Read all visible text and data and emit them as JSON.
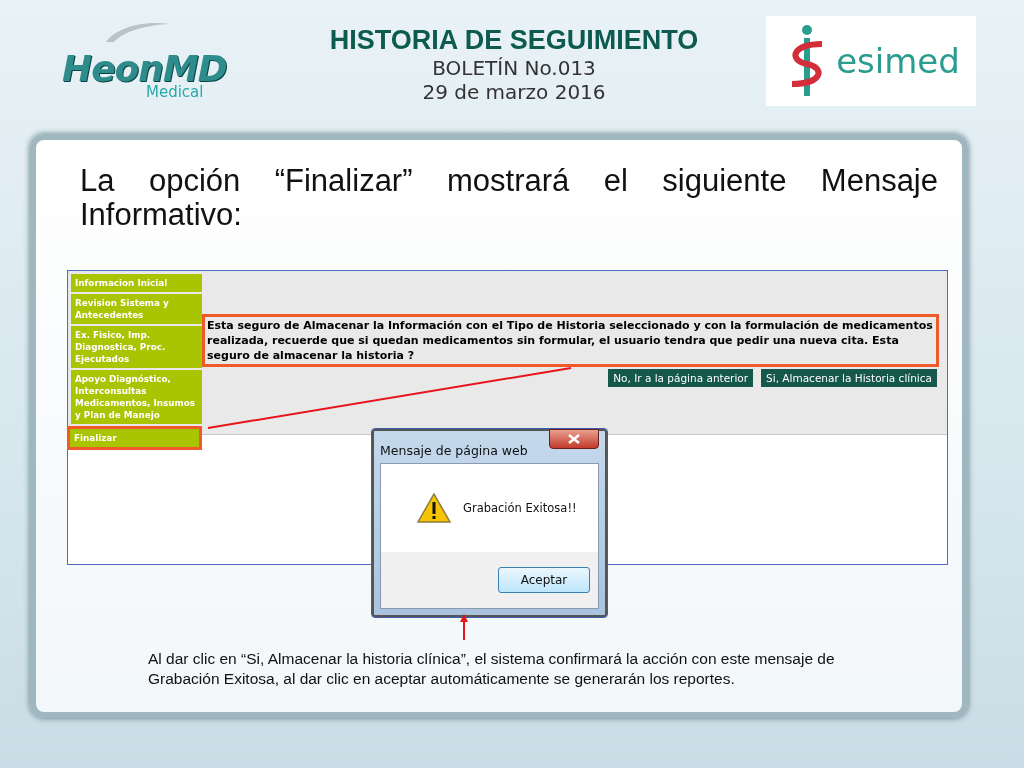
{
  "header": {
    "logo_left": {
      "name": "HeonMD",
      "sub": "Medical"
    },
    "title": "HISTORIA DE SEGUIMIENTO",
    "bulletin": "BOLETÍN No.013",
    "date": "29 de marzo 2016",
    "logo_right": {
      "name": "esimed"
    }
  },
  "heading": "La opción “Finalizar” mostrará el siguiente Mensaje Informativo:",
  "screenshot": {
    "menu": [
      {
        "label": "Informacion Inicial",
        "highlighted": false
      },
      {
        "label": "Revision Sistema y Antecedentes",
        "highlighted": false
      },
      {
        "label": "Ex. Fisico, Imp. Diagnostica, Proc. Ejecutados",
        "highlighted": false
      },
      {
        "label": "Apoyo Diagnóstico, Interconsultas Medicamentos, Insumos y Plan de Manejo",
        "highlighted": false
      },
      {
        "label": "Finalizar",
        "highlighted": true
      }
    ],
    "message": {
      "text": "Esta seguro de Almacenar la Información con el Tipo de Historia seleccionado y con la formulación de medicamentos realizada, recuerde que si quedan medicamentos sin formular, el usuario tendra que pedir una nueva cita. Esta seguro de almacenar la historia ?",
      "highlighted": true
    },
    "buttons": [
      "No, Ir a la página anterior",
      "Si, Almacenar la Historia clínica"
    ],
    "dialog": {
      "title": "Mensaje de página web",
      "message": "Grabación Exitosa!!",
      "button": "Aceptar"
    }
  },
  "caption": "Al dar clic en “Si, Almacenar la historia clínica”, el sistema confirmará la acción con este mensaje de Grabación Exitosa, al dar clic en aceptar automáticamente se generarán los reportes."
}
